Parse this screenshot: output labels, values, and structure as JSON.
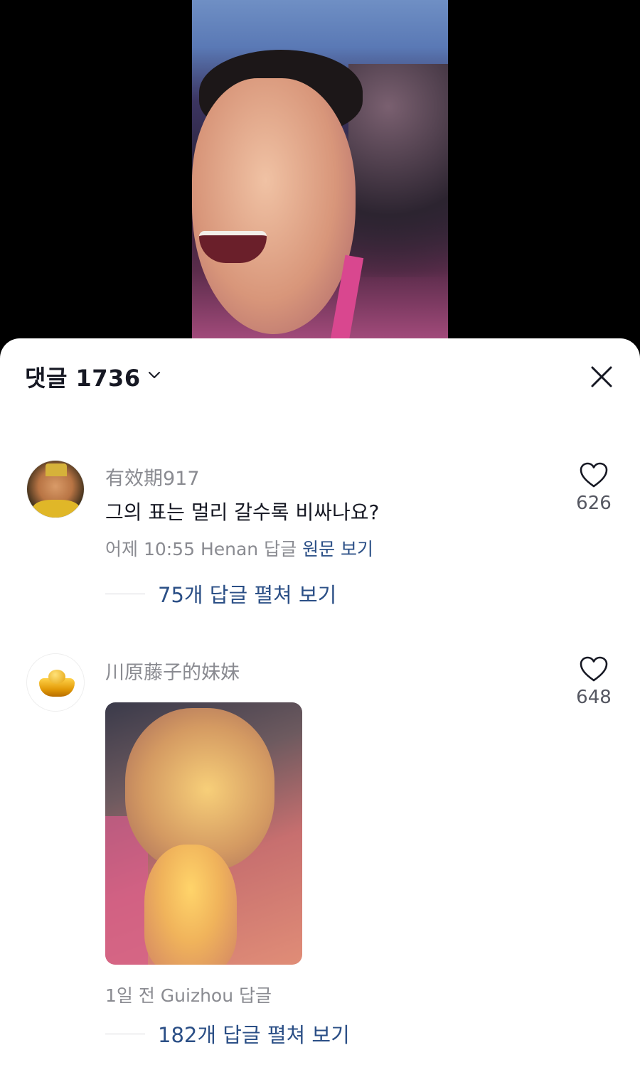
{
  "video": {
    "content": "video-frame"
  },
  "comments_sheet": {
    "title": "댓글 1736",
    "close_icon": "close-icon",
    "expand_icon": "chevron-down-icon"
  },
  "comments": [
    {
      "username": "有效期917",
      "text": "그의 표는 멀리 갈수록 비싸나요?",
      "meta": "어제 10:55 Henan 답글",
      "translate_label": "원문 보기",
      "replies_label": "75개 답글 펼쳐 보기",
      "likes": "626",
      "avatar": "avatar"
    },
    {
      "username": "川原藤子的妹妹",
      "text": "",
      "image": "comment-image",
      "meta": "1일 전 Guizhou 답글",
      "replies_label": "182개 답글 펼쳐 보기",
      "likes": "648",
      "avatar": "gold-ingot-avatar"
    }
  ],
  "colors": {
    "accent_link": "#2b4f86",
    "muted_text": "#8a8b91",
    "primary_text": "#161823"
  }
}
